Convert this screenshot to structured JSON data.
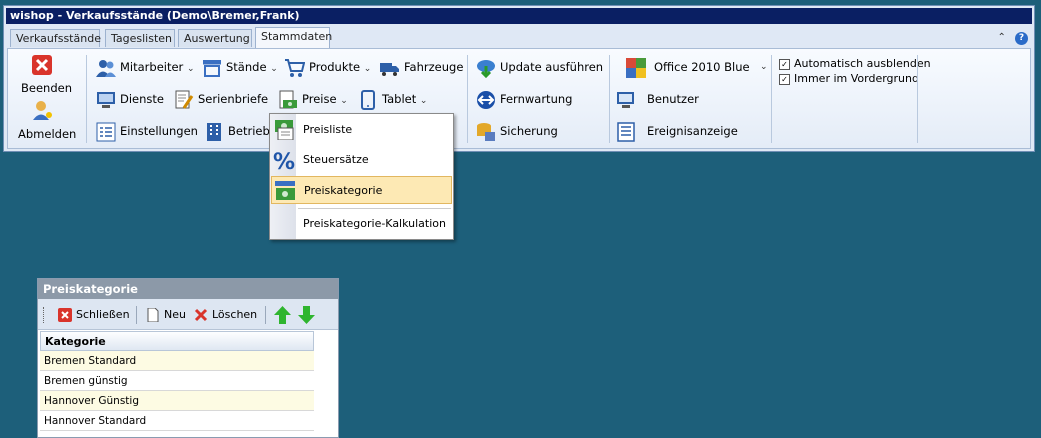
{
  "window": {
    "title": "wishop - Verkaufsstände (Demo\\Bremer,Frank)"
  },
  "tabs": [
    {
      "label": "Verkaufsstände",
      "active": false
    },
    {
      "label": "Tageslisten",
      "active": false
    },
    {
      "label": "Auswertung",
      "active": false
    },
    {
      "label": "Stammdaten",
      "active": true
    }
  ],
  "ribbon": {
    "beenden": "Beenden",
    "abmelden": "Abmelden",
    "mitarbeiter": "Mitarbeiter",
    "staende": "Stände",
    "produkte": "Produkte",
    "fahrzeuge": "Fahrzeuge",
    "dienste": "Dienste",
    "serienbriefe": "Serienbriefe",
    "preise": "Preise",
    "tablet": "Tablet",
    "einstellungen": "Einstellungen",
    "betriebe": "Betriebe",
    "update": "Update ausführen",
    "fernwartung": "Fernwartung",
    "sicherung": "Sicherung",
    "theme": "Office 2010 Blue",
    "benutzer": "Benutzer",
    "ereignisanzeige": "Ereignisanzeige",
    "auto_hide": "Automatisch ausblenden",
    "always_top": "Immer im Vordergrund"
  },
  "preise_menu": [
    {
      "label": "Preisliste"
    },
    {
      "label": "Steuersätze"
    },
    {
      "label": "Preiskategorie"
    },
    {
      "label": "Preiskategorie-Kalkulation"
    }
  ],
  "panel": {
    "title": "Preiskategorie",
    "toolbar": {
      "close": "Schließen",
      "new": "Neu",
      "delete": "Löschen"
    },
    "column": "Kategorie",
    "rows": [
      "Bremen Standard",
      "Bremen günstig",
      "Hannover Günstig",
      "Hannover Standard"
    ]
  },
  "colors": {
    "background": "#1d5f7a",
    "titlebar": "#0a1f63",
    "highlight": "#fde9b4"
  }
}
